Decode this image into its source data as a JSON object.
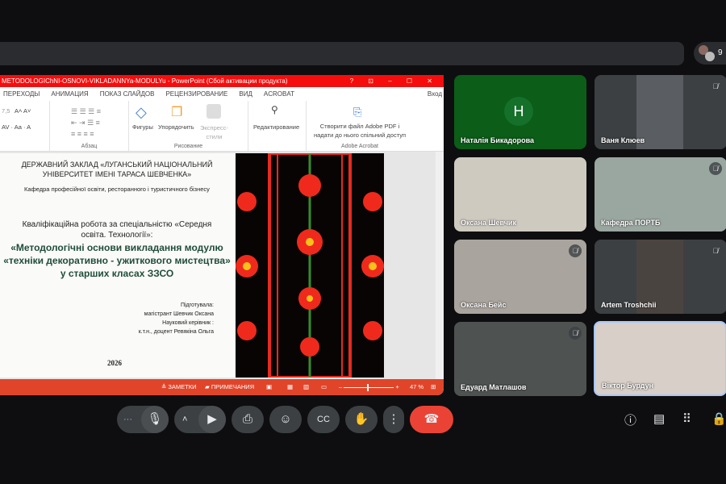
{
  "powerpoint": {
    "title": "METODOLOGIChNI-OSNOVI-VIKLADANNYa-MODULYu -  PowerPoint (Сбой активации продукта)",
    "window_controls": "? ⊡ – ☐ ✕",
    "tabs": [
      "ПЕРЕХОДЫ",
      "АНИМАЦИЯ",
      "ПОКАЗ СЛАЙДОВ",
      "РЕЦЕНЗИРОВАНИЕ",
      "ВИД",
      "ACROBAT"
    ],
    "signin": "Вход",
    "ribbon": {
      "font_size": "7,5",
      "paragraph_group": "Абзац",
      "shapes": "Фигуры",
      "arrange": "Упорядочить",
      "quick_styles": "Экспресс-\nстили",
      "drawing_group": "Рисование",
      "editing": "Редактирование",
      "acrobat_create": "Створити файл Adobe PDF і надати до нього спільний доступ",
      "acrobat_group": "Adobe Acrobat"
    },
    "slide": {
      "institution": "ДЕРЖАВНИЙ ЗАКЛАД «ЛУГАНСЬКИЙ НАЦІОНАЛЬНИЙ УНІВЕРСИТЕТ ІМЕНІ ТАРАСА ШЕВЧЕНКА»",
      "department": "Кафедра професійної освіти, ресторанного і туристичного бізнесу",
      "work_type": "Кваліфікаційна робота за спеціальністю «Середня освіта. Технології»:",
      "topic": "«Методологічні основи викладання модулю «техніки декоративно - ужиткового мистецтва» у старших класах ЗЗСО",
      "prepared_label": "Підготувала:",
      "student": "магістрант Шевчик Оксана",
      "supervisor_label": "Науковий керівник :",
      "supervisor": "к.т.н., доцент Ревякіна Ольга",
      "year": "2026"
    },
    "status": {
      "notes": "ЗАМЕТКИ",
      "comments": "ПРИМЕЧАНИЯ",
      "zoom": "47 %",
      "zoom_value": 47
    }
  },
  "participants_count": "9",
  "tiles": [
    {
      "name": "Наталія Бикадорова",
      "initial": "H",
      "muted": false,
      "bg": "#0b5d18"
    },
    {
      "name": "Ваня Клюев",
      "muted": true,
      "bg": "#5a5e63"
    },
    {
      "name": "Оксана Шевчик",
      "muted": false,
      "bg": "#cfcac0"
    },
    {
      "name": "Кафедра ПОРТБ",
      "muted": true,
      "bg": "#9aa6a0"
    },
    {
      "name": "Оксана Бейс",
      "muted": true,
      "bg": "#a9a49d"
    },
    {
      "name": "Artem Troshchii",
      "muted": true,
      "bg": "#4a4440"
    },
    {
      "name": "Едуард Матлашов",
      "muted": true,
      "bg": "#4e5250"
    },
    {
      "name": "Віктор Бурдун",
      "muted": false,
      "bg": "#d8cfc8",
      "active": true
    }
  ],
  "colors": {
    "end_call": "#ea4335",
    "ppt_title": "#f50d0d",
    "ppt_status": "#e0452a",
    "topic_green": "#1f4d3a"
  }
}
